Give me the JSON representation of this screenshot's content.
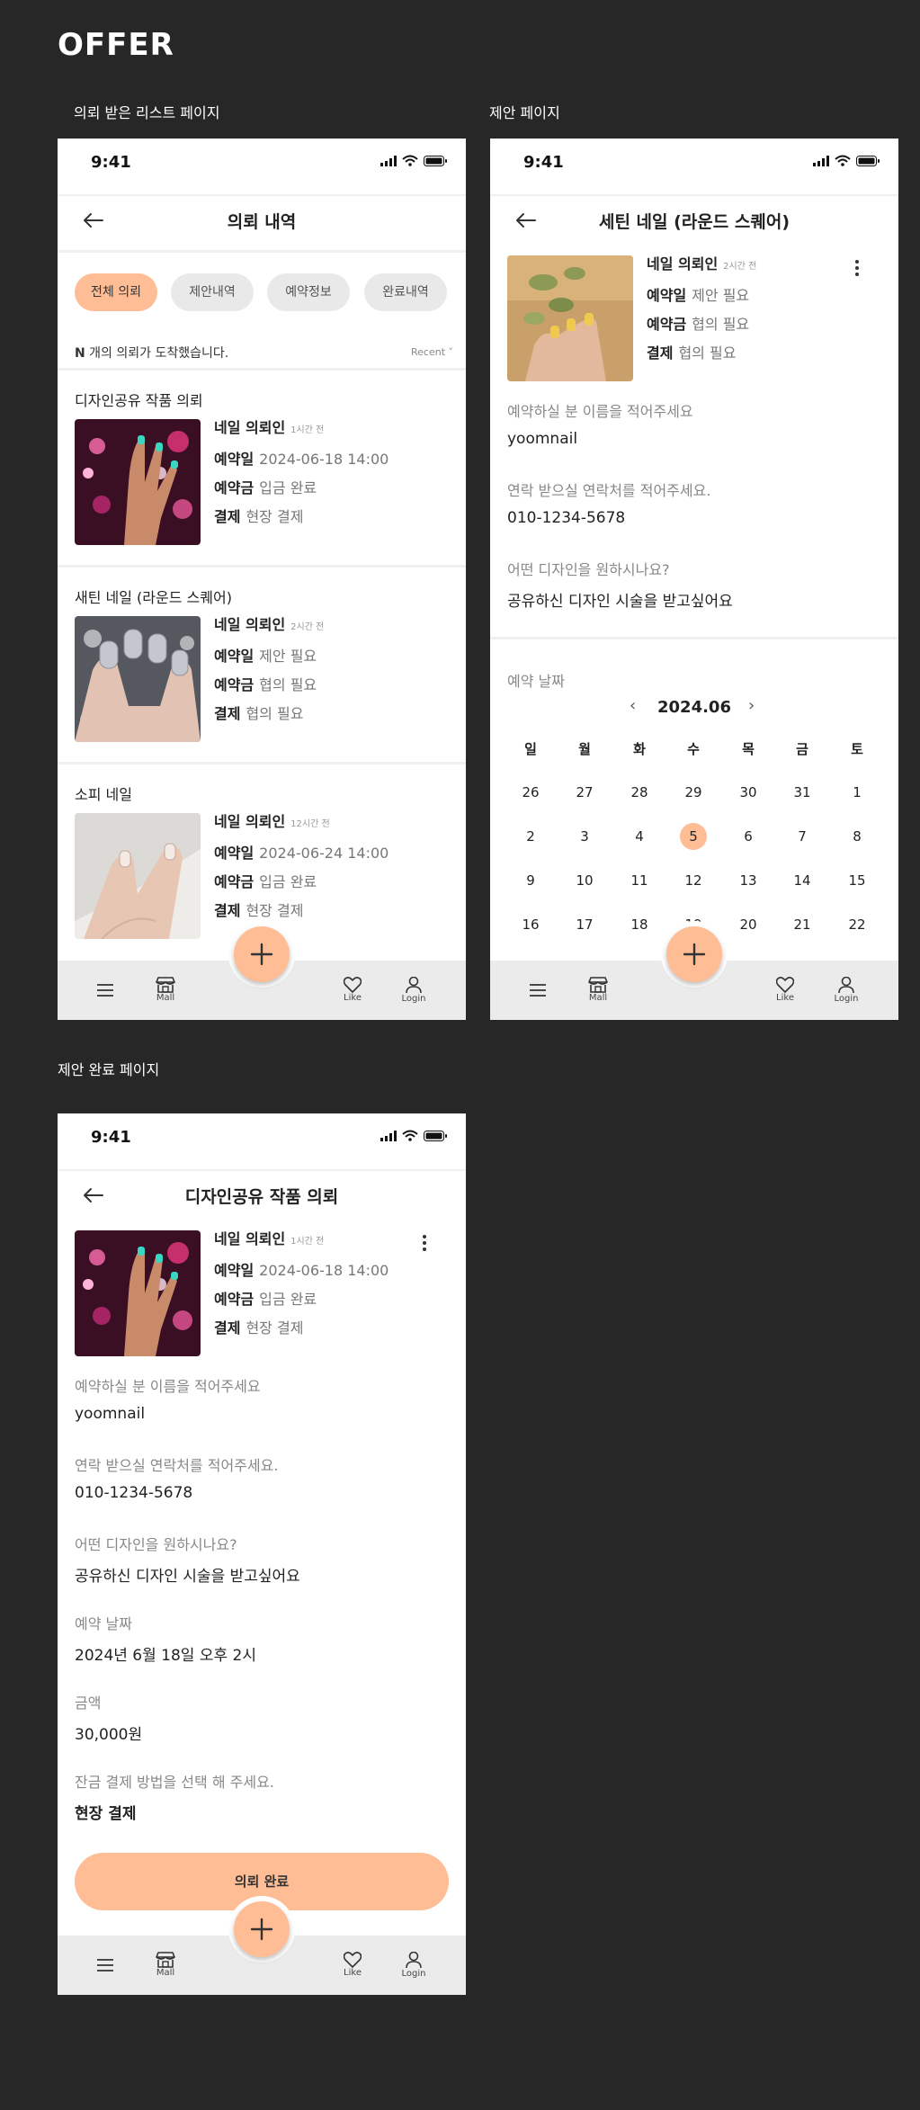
{
  "page_title": "OFFER",
  "section_labels": {
    "list": "의뢰 받은 리스트 페이지",
    "proposal": "제안 페이지",
    "complete": "제안 완료 페이지"
  },
  "status_time": "9:41",
  "tabbar": {
    "mall": "Mall",
    "like": "Like",
    "login": "Login"
  },
  "screen1": {
    "title": "의뢰 내역",
    "chips": [
      "전체 의뢰",
      "제안내역",
      "예약정보",
      "완료내역"
    ],
    "count_prefix": "N",
    "count_text": " 개의 의뢰가 도착했습니다.",
    "sort": "Recent ˅",
    "items": [
      {
        "title": "디자인공유 작품 의뢰",
        "requester": "네일 의뢰인",
        "ago": "1시간 전",
        "row1_key": "예약일",
        "row1_val": "2024-06-18 14:00",
        "row2_key": "예약금",
        "row2_val": "입금 완료",
        "row3_key": "결제",
        "row3_val": "현장 결제"
      },
      {
        "title": "새틴 네일 (라운드 스퀘어)",
        "requester": "네일 의뢰인",
        "ago": "2시간 전",
        "row1_key": "예약일",
        "row1_val": "제안 필요",
        "row2_key": "예약금",
        "row2_val": "협의 필요",
        "row3_key": "결제",
        "row3_val": "협의 필요"
      },
      {
        "title": "소피 네일",
        "requester": "네일 의뢰인",
        "ago": "12시간 전",
        "row1_key": "예약일",
        "row1_val": "2024-06-24 14:00",
        "row2_key": "예약금",
        "row2_val": "입금 완료",
        "row3_key": "결제",
        "row3_val": "현장 결제"
      }
    ]
  },
  "screen2": {
    "title": "세틴 네일 (라운드 스퀘어)",
    "requester": "네일 의뢰인",
    "ago": "2시간 전",
    "row1_key": "예약일",
    "row1_val": "제안 필요",
    "row2_key": "예약금",
    "row2_val": "협의 필요",
    "row3_key": "결제",
    "row3_val": "협의 필요",
    "q_name": "예약하실 분 이름을 적어주세요",
    "a_name": "yoomnail",
    "q_contact": "연락 받으실 연락처를 적어주세요.",
    "a_contact": "010-1234-5678",
    "q_design": "어떤 디자인을 원하시나요?",
    "a_design": "공유하신 디자인 시술을 받고싶어요",
    "date_label": "예약 날짜",
    "month": "2024.06",
    "prev": "‹",
    "next": "›",
    "weekdays": [
      "일",
      "월",
      "화",
      "수",
      "목",
      "금",
      "토"
    ],
    "days": [
      [
        "26",
        "27",
        "28",
        "29",
        "30",
        "31",
        "1"
      ],
      [
        "2",
        "3",
        "4",
        "5",
        "6",
        "7",
        "8"
      ],
      [
        "9",
        "10",
        "11",
        "12",
        "13",
        "14",
        "15"
      ],
      [
        "16",
        "17",
        "18",
        "19",
        "20",
        "21",
        "22"
      ]
    ],
    "selected_day": "5"
  },
  "screen3": {
    "title": "디자인공유 작품 의뢰",
    "requester": "네일 의뢰인",
    "ago": "1시간 전",
    "row1_key": "예약일",
    "row1_val": "2024-06-18 14:00",
    "row2_key": "예약금",
    "row2_val": "입금 완료",
    "row3_key": "결제",
    "row3_val": "현장 결제",
    "q_name": "예약하실 분 이름을 적어주세요",
    "a_name": "yoomnail",
    "q_contact": "연락 받으실 연락처를 적어주세요.",
    "a_contact": "010-1234-5678",
    "q_design": "어떤 디자인을 원하시나요?",
    "a_design": "공유하신 디자인 시술을 받고싶어요",
    "q_date": "예약 날짜",
    "a_date": "2024년 6월 18일 오후 2시",
    "q_amount": "금액",
    "a_amount": "30,000원",
    "q_payment": "잔금 결제 방법을 선택 해 주세요.",
    "a_payment": "현장 결제",
    "cta": "의뢰 완료"
  },
  "colors": {
    "accent": "#ffbd95",
    "background": "#272727",
    "tabbar": "#ebebeb"
  }
}
